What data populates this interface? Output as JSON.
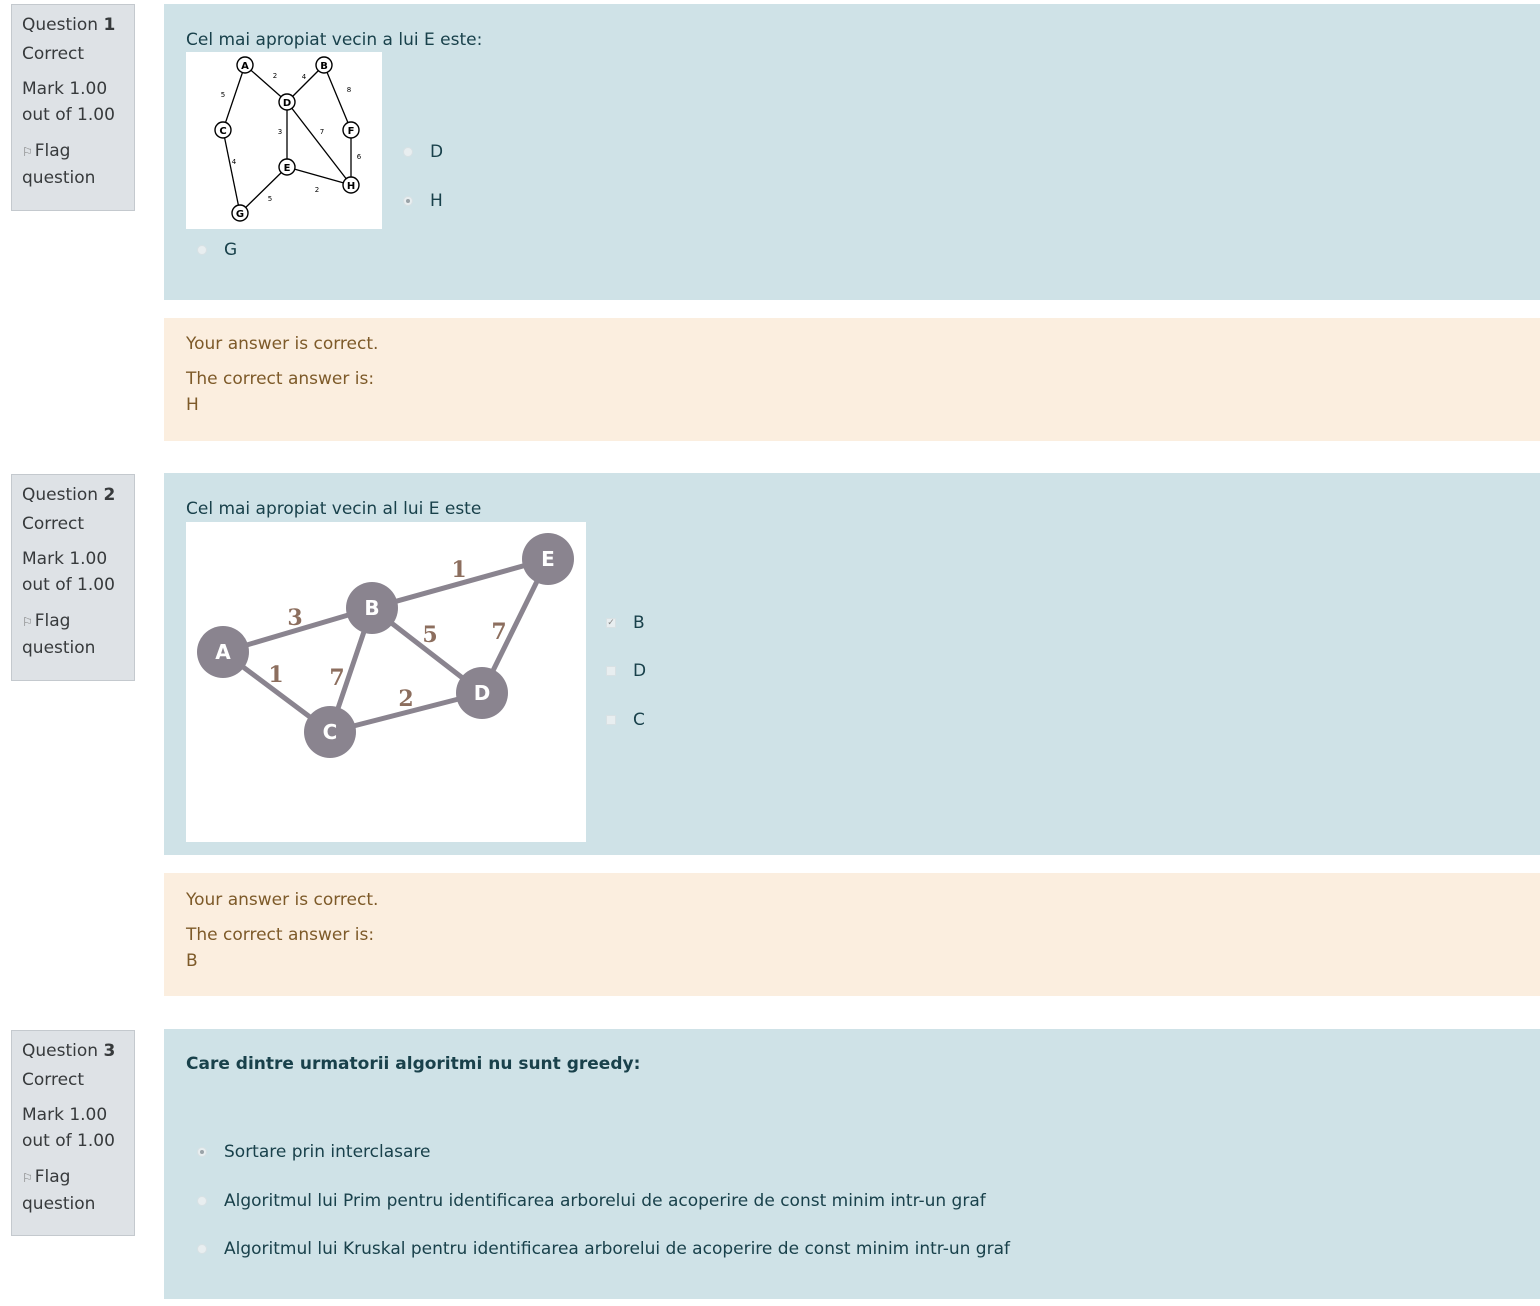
{
  "questions": [
    {
      "label": "Question",
      "number": "1",
      "state": "Correct",
      "mark_line1": "Mark 1.00",
      "mark_line2": "out of 1.00",
      "flag_line1": "Flag",
      "flag_line2": "question",
      "text": "Cel mai apropiat vecin a lui E este:",
      "options": [
        {
          "label": "D",
          "selected": false
        },
        {
          "label": "H",
          "selected": true
        },
        {
          "label": "G",
          "selected": false
        }
      ],
      "graph": {
        "nodes": [
          "A",
          "B",
          "C",
          "D",
          "E",
          "F",
          "G",
          "H"
        ],
        "edge_weights": [
          "2",
          "4",
          "8",
          "5",
          "3",
          "7",
          "6",
          "4",
          "2",
          "5"
        ]
      },
      "feedback_result": "Your answer is correct.",
      "feedback_label": "The correct answer is:",
      "feedback_answer": "H"
    },
    {
      "label": "Question",
      "number": "2",
      "state": "Correct",
      "mark_line1": "Mark 1.00",
      "mark_line2": "out of 1.00",
      "flag_line1": "Flag",
      "flag_line2": "question",
      "text": "Cel mai apropiat vecin al lui E este",
      "options": [
        {
          "label": "B",
          "selected": true
        },
        {
          "label": "D",
          "selected": false
        },
        {
          "label": "C",
          "selected": false
        }
      ],
      "graph": {
        "nodes": [
          "A",
          "B",
          "C",
          "D",
          "E"
        ],
        "edge_weights": [
          "3",
          "1",
          "7",
          "5",
          "1",
          "7",
          "2"
        ]
      },
      "feedback_result": "Your answer is correct.",
      "feedback_label": "The correct answer is:",
      "feedback_answer": "B"
    },
    {
      "label": "Question",
      "number": "3",
      "state": "Correct",
      "mark_line1": "Mark 1.00",
      "mark_line2": "out of 1.00",
      "flag_line1": "Flag",
      "flag_line2": "question",
      "text": "Care dintre urmatorii algoritmi nu sunt greedy:",
      "options": [
        {
          "label": "Sortare prin interclasare",
          "selected": true
        },
        {
          "label": "Algoritmul lui Prim pentru identificarea arborelui de acoperire de const minim intr-un graf",
          "selected": false
        },
        {
          "label": "Algoritmul lui Kruskal pentru identificarea arborelui de acoperire de const minim intr-un graf",
          "selected": false
        }
      ]
    }
  ],
  "colors": {
    "info_bg": "#dee2e6",
    "formulation_bg": "#cfe2e7",
    "feedback_bg": "#fbeedf",
    "feedback_text": "#7d5a29",
    "node_gray": "#8a848f",
    "weight_brown": "#8c6e5e"
  }
}
